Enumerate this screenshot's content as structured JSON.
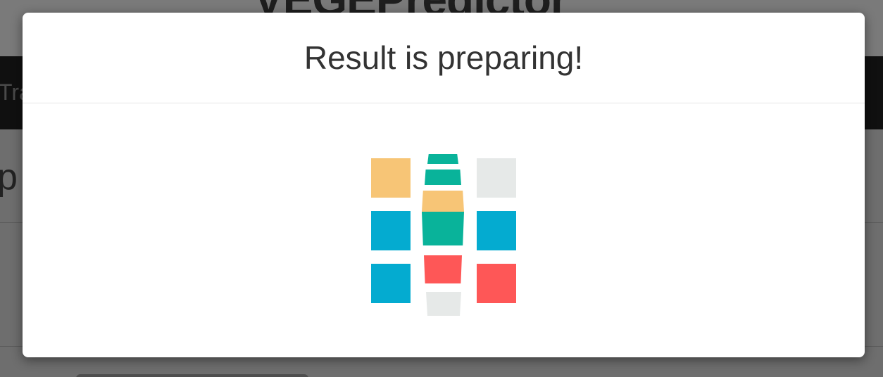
{
  "background": {
    "logo_text": "VEGEPredictor",
    "nav_item": "Tra",
    "heading": "p"
  },
  "modal": {
    "title": "Result is preparing!"
  },
  "loader": {
    "colors": {
      "orange": "#f7c576",
      "teal": "#09b39a",
      "blue": "#04abd0",
      "red": "#fe5757",
      "gray": "#e6e9e8"
    },
    "grid": [
      [
        "orange",
        "teal",
        "gray"
      ],
      [
        "blue",
        "teal",
        "blue"
      ],
      [
        "blue",
        "red",
        "red"
      ]
    ]
  }
}
